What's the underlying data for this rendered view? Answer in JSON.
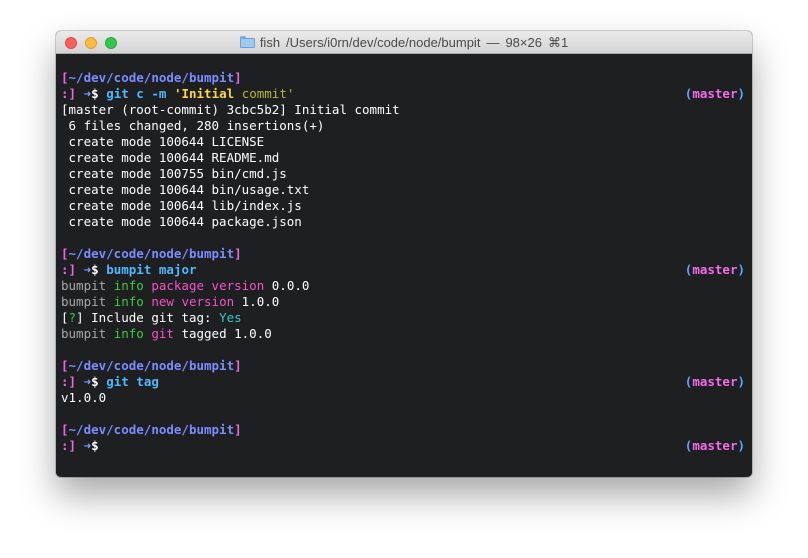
{
  "window": {
    "title_app": "fish",
    "title_path": "/Users/i0rn/dev/code/node/bumpit",
    "title_sep": "—",
    "title_size": "98×26",
    "title_shortcut": "⌘1",
    "close_glyph": "×",
    "minimize_glyph": "−",
    "zoom_glyph": "+"
  },
  "prompt": {
    "path_open": "[",
    "path": "~/dev/code/node/bumpit",
    "path_close": "]",
    "face": ":]",
    "arrow": "➜",
    "dollar": "$",
    "branch_open": "(",
    "branch": "master",
    "branch_close": ")"
  },
  "session": {
    "cmd1": {
      "git": "git",
      "sub": "c",
      "flag": "-m",
      "msg_a": "'Initial",
      "msg_b": "commit'"
    },
    "out1": [
      "[master (root-commit) 3cbc5b2] Initial commit",
      " 6 files changed, 280 insertions(+)",
      " create mode 100644 LICENSE",
      " create mode 100644 README.md",
      " create mode 100755 bin/cmd.js",
      " create mode 100644 bin/usage.txt",
      " create mode 100644 lib/index.js",
      " create mode 100644 package.json"
    ],
    "cmd2": {
      "prog": "bumpit",
      "arg": "major"
    },
    "out2": {
      "l1": {
        "a": "bumpit",
        "b": "info",
        "c": "package",
        "d": "version",
        "e": "0.0.0"
      },
      "l2": {
        "a": "bumpit",
        "b": "info",
        "c": "new",
        "d": "version",
        "e": "1.0.0"
      },
      "l3": {
        "open": "[",
        "q": "?",
        "close": "]",
        "text": "Include git tag:",
        "answer": "Yes"
      },
      "l4": {
        "a": "bumpit",
        "b": "info",
        "c": "git",
        "d": "tagged",
        "e": "1.0.0"
      }
    },
    "cmd3": {
      "git": "git",
      "sub": "tag"
    },
    "out3": "v1.0.0"
  },
  "colors": {
    "background": "#1d1f21",
    "path": "#ee66ee",
    "command": "#4fb8ff",
    "quote": "#ffd447",
    "info": "#42c743",
    "keyword": "#f553c8",
    "answer": "#35c7c7",
    "branch": "#f06ee8"
  }
}
